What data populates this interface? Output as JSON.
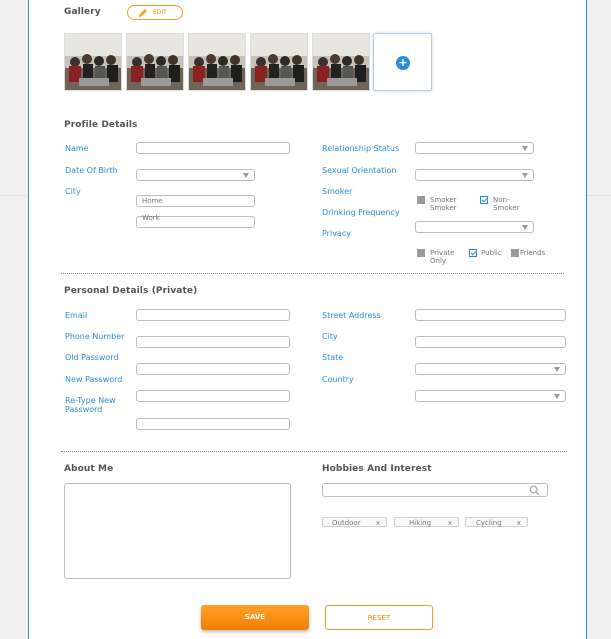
{
  "gallery": {
    "title": "Gallery",
    "edit_label": "EDIT",
    "add_symbol": "+",
    "photo_count": 5
  },
  "profile": {
    "title": "Profile Details",
    "labels": {
      "name": "Name",
      "dob": "Date Of Birth",
      "city": "City",
      "relationship": "Relationship Status",
      "orientation": "Sexual Orientation",
      "smoker": "Smoker",
      "drinking": "Drinking Frequency",
      "privacy": "Privacy"
    },
    "city_placeholders": {
      "home": "Home",
      "work": "Work"
    },
    "smoker_options": {
      "smoker": "Smoker Smoker",
      "non_smoker": "Non-Smoker"
    },
    "privacy_options": {
      "private": "Private Only",
      "public": "Public",
      "friends": "Friends"
    }
  },
  "personal": {
    "title": "Personal Details (Private)",
    "labels": {
      "email": "Email",
      "phone": "Phone Number",
      "old_password": "Old Password",
      "new_password": "New Password",
      "retype_password": "Re-Type New Password",
      "street": "Street Address",
      "city": "City",
      "state": "State",
      "country": "Country"
    }
  },
  "about": {
    "title": "About Me"
  },
  "hobbies": {
    "title": "Hobbies And Interest",
    "tags": [
      {
        "label": "Outdoor",
        "remove": "x"
      },
      {
        "label": "Hiking",
        "remove": "x"
      },
      {
        "label": "Cycling",
        "remove": "x"
      }
    ]
  },
  "actions": {
    "save": "SAVE",
    "reset": "RESET"
  },
  "colors": {
    "accent": "#2b8ed0",
    "brand": "#f57f00"
  }
}
